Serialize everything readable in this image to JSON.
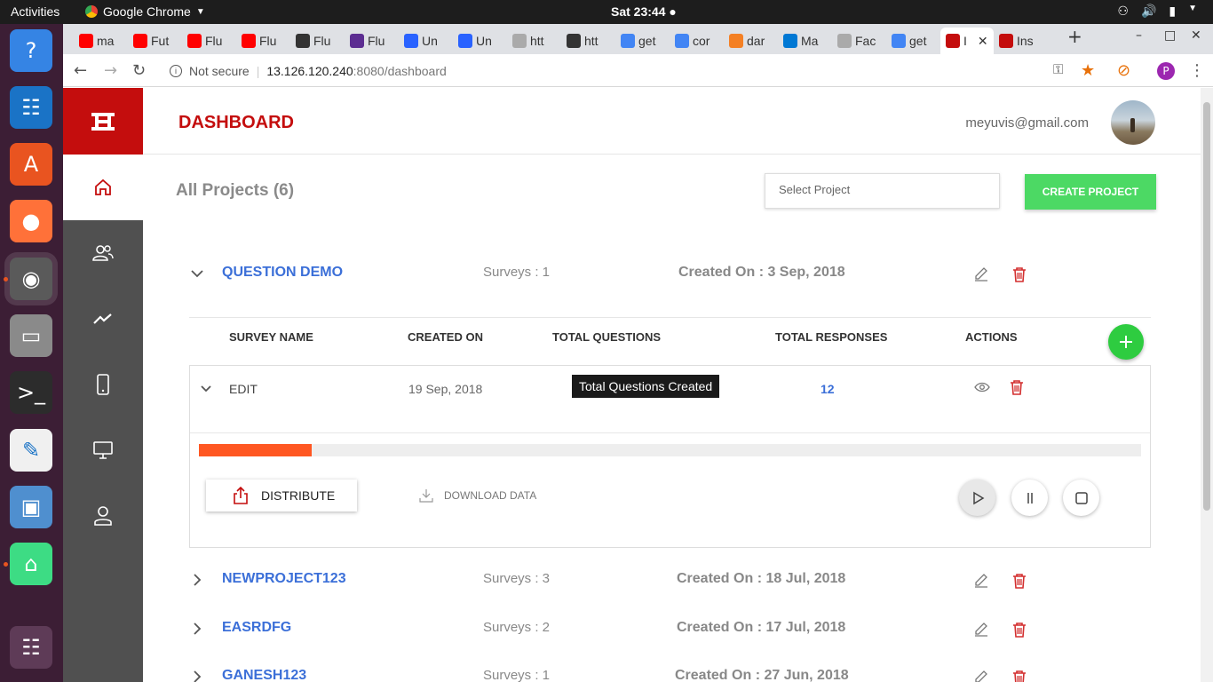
{
  "os": {
    "activities": "Activities",
    "app_name": "Google Chrome",
    "clock": "Sat 23:44 ●",
    "dock": [
      {
        "name": "help-icon",
        "glyph": "?",
        "bg": "#3584e4"
      },
      {
        "name": "writer-icon",
        "glyph": "☷",
        "bg": "#1a73c6"
      },
      {
        "name": "software-icon",
        "glyph": "A",
        "bg": "#e95420"
      },
      {
        "name": "firefox-icon",
        "glyph": "●",
        "bg": "#ff7139"
      },
      {
        "name": "chrome-icon",
        "glyph": "◉",
        "bg": "#5a5a5a"
      },
      {
        "name": "files-icon",
        "glyph": "▭",
        "bg": "#8a8a8a"
      },
      {
        "name": "terminal-icon",
        "glyph": ">_",
        "bg": "#2c2c2c"
      },
      {
        "name": "text-editor-icon",
        "glyph": "✎",
        "bg": "#f0f0f0"
      },
      {
        "name": "virtualbox-icon",
        "glyph": "▣",
        "bg": "#4f8fcf"
      },
      {
        "name": "android-studio-icon",
        "glyph": "⌂",
        "bg": "#3ddc84"
      }
    ],
    "apps_grid_glyph": "☷"
  },
  "browser": {
    "tabs": [
      {
        "label": "ma",
        "fav": "#ff0000"
      },
      {
        "label": "Fut",
        "fav": "#ff0000"
      },
      {
        "label": "Flu",
        "fav": "#ff0000"
      },
      {
        "label": "Flu",
        "fav": "#ff0000"
      },
      {
        "label": "Flu",
        "fav": "#333333"
      },
      {
        "label": "Flu",
        "fav": "#5c2d91"
      },
      {
        "label": "Un",
        "fav": "#2962ff"
      },
      {
        "label": "Un",
        "fav": "#2962ff"
      },
      {
        "label": "htt",
        "fav": "#aaaaaa"
      },
      {
        "label": "htt",
        "fav": "#333333"
      },
      {
        "label": "get",
        "fav": "#4285f4"
      },
      {
        "label": "cor",
        "fav": "#4285f4"
      },
      {
        "label": "dar",
        "fav": "#f48024"
      },
      {
        "label": "Ma",
        "fav": "#0078d4"
      },
      {
        "label": "Fac",
        "fav": "#aaaaaa"
      },
      {
        "label": "get",
        "fav": "#4285f4"
      },
      {
        "label": "I",
        "fav": "#c40d0d",
        "active": true
      },
      {
        "label": "Ins",
        "fav": "#c40d0d"
      }
    ],
    "new_tab": "+",
    "url_security": "Not secure",
    "url_host": "13.126.120.240",
    "url_path": ":8080/dashboard",
    "profile_initial": "P"
  },
  "app": {
    "title": "DASHBOARD",
    "user_email": "meyuvis@gmail.com",
    "all_projects": "All Projects (6)",
    "select_placeholder": "Select Project",
    "create_button": "CREATE PROJECT",
    "projects": [
      {
        "name": "QUESTION DEMO",
        "surveys": "Surveys : 1",
        "created": "Created On : 3 Sep, 2018",
        "expanded": true
      },
      {
        "name": "NEWPROJECT123",
        "surveys": "Surveys : 3",
        "created": "Created On : 18 Jul, 2018",
        "expanded": false
      },
      {
        "name": "EASRDFG",
        "surveys": "Surveys : 2",
        "created": "Created On : 17 Jul, 2018",
        "expanded": false
      },
      {
        "name": "GANESH123",
        "surveys": "Surveys : 1",
        "created": "Created On : 27 Jun, 2018",
        "expanded": false
      }
    ],
    "survey_table": {
      "headers": {
        "name": "SURVEY NAME",
        "created": "CREATED ON",
        "questions": "TOTAL QUESTIONS",
        "responses": "TOTAL RESPONSES",
        "actions": "ACTIONS"
      },
      "rows": [
        {
          "name": "EDIT",
          "created": "19 Sep, 2018",
          "responses": "12"
        }
      ],
      "tooltip": "Total Questions Created",
      "progress_fraction": 0.12,
      "distribute": "DISTRIBUTE",
      "download": "DOWNLOAD DATA"
    }
  },
  "colors": {
    "brand": "#c40d0d",
    "link": "#3b6fd8",
    "green": "#4cd964",
    "progress": "#ff5722",
    "sidebar": "#505050"
  }
}
